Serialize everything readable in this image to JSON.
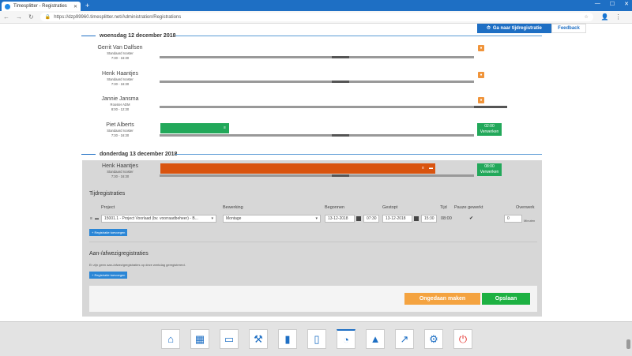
{
  "browser": {
    "tab_title": "Timesplitter - Registraties",
    "url": "https://dzp99960.timesplitter.net/Administration/Registrations"
  },
  "top": {
    "tijd_button": "Ga naar tijdregistratie",
    "feedback_button": "Feedback"
  },
  "days": [
    {
      "label": "woensdag 12 december 2018"
    },
    {
      "label": "donderdag 13 december 2018"
    }
  ],
  "people": [
    {
      "name": "Gerrit Van Dalfsen",
      "roster": "Standaard rooster",
      "time": "7:30 - 16:30"
    },
    {
      "name": "Henk Haantjes",
      "roster": "Standaard rooster",
      "time": "7:30 - 16:30"
    },
    {
      "name": "Jannie Jansma",
      "roster": "Rooster ADM",
      "time": "8:00 - 12:30"
    },
    {
      "name": "Piet Alberts",
      "roster": "Standaard rooster",
      "time": "7:30 - 16:30",
      "box_time": "02:00",
      "box_label": "Verwerken"
    },
    {
      "name": "Henk Haantjes",
      "roster": "Standaard rooster",
      "time": "7:30 - 16:30",
      "box_time": "08:00",
      "box_label": "Verwerken"
    }
  ],
  "tijdregistraties": {
    "title": "Tijdregistraties",
    "headers": {
      "project": "Project",
      "bewerking": "Bewerking",
      "begonnen": "Begonnen",
      "gestopt": "Gestopt",
      "tijd": "Tijd",
      "pauze": "Pauze gewerkt",
      "overwerk": "Overwerk"
    },
    "row": {
      "project": "15001.1 - Project Voorlaad (bv. voorraadbeheer) - B...",
      "bewerking": "Montage",
      "begonnen_date": "13-12-2018",
      "begonnen_time": "07:30",
      "gestopt_date": "13-12-2018",
      "gestopt_time": "15:30",
      "tijd": "08:00",
      "pauze": "✔",
      "overwerk": "0",
      "overwerk_unit": "Minuten"
    },
    "add_button": "+ Registratie toevoegen"
  },
  "afwezig": {
    "title": "Aan-/afwezigregistraties",
    "info": "Er zijn geen aan-/afwezigregistraties op deze werkdag geregistreerd.",
    "add_button": "+ Registratie toevoegen"
  },
  "actions": {
    "undo": "Ongedaan maken",
    "save": "Opslaan"
  },
  "colors": {
    "primary": "#1e6fc4",
    "green": "#22a85a",
    "orange": "#f0943a",
    "bar_orange": "#d9540f"
  }
}
